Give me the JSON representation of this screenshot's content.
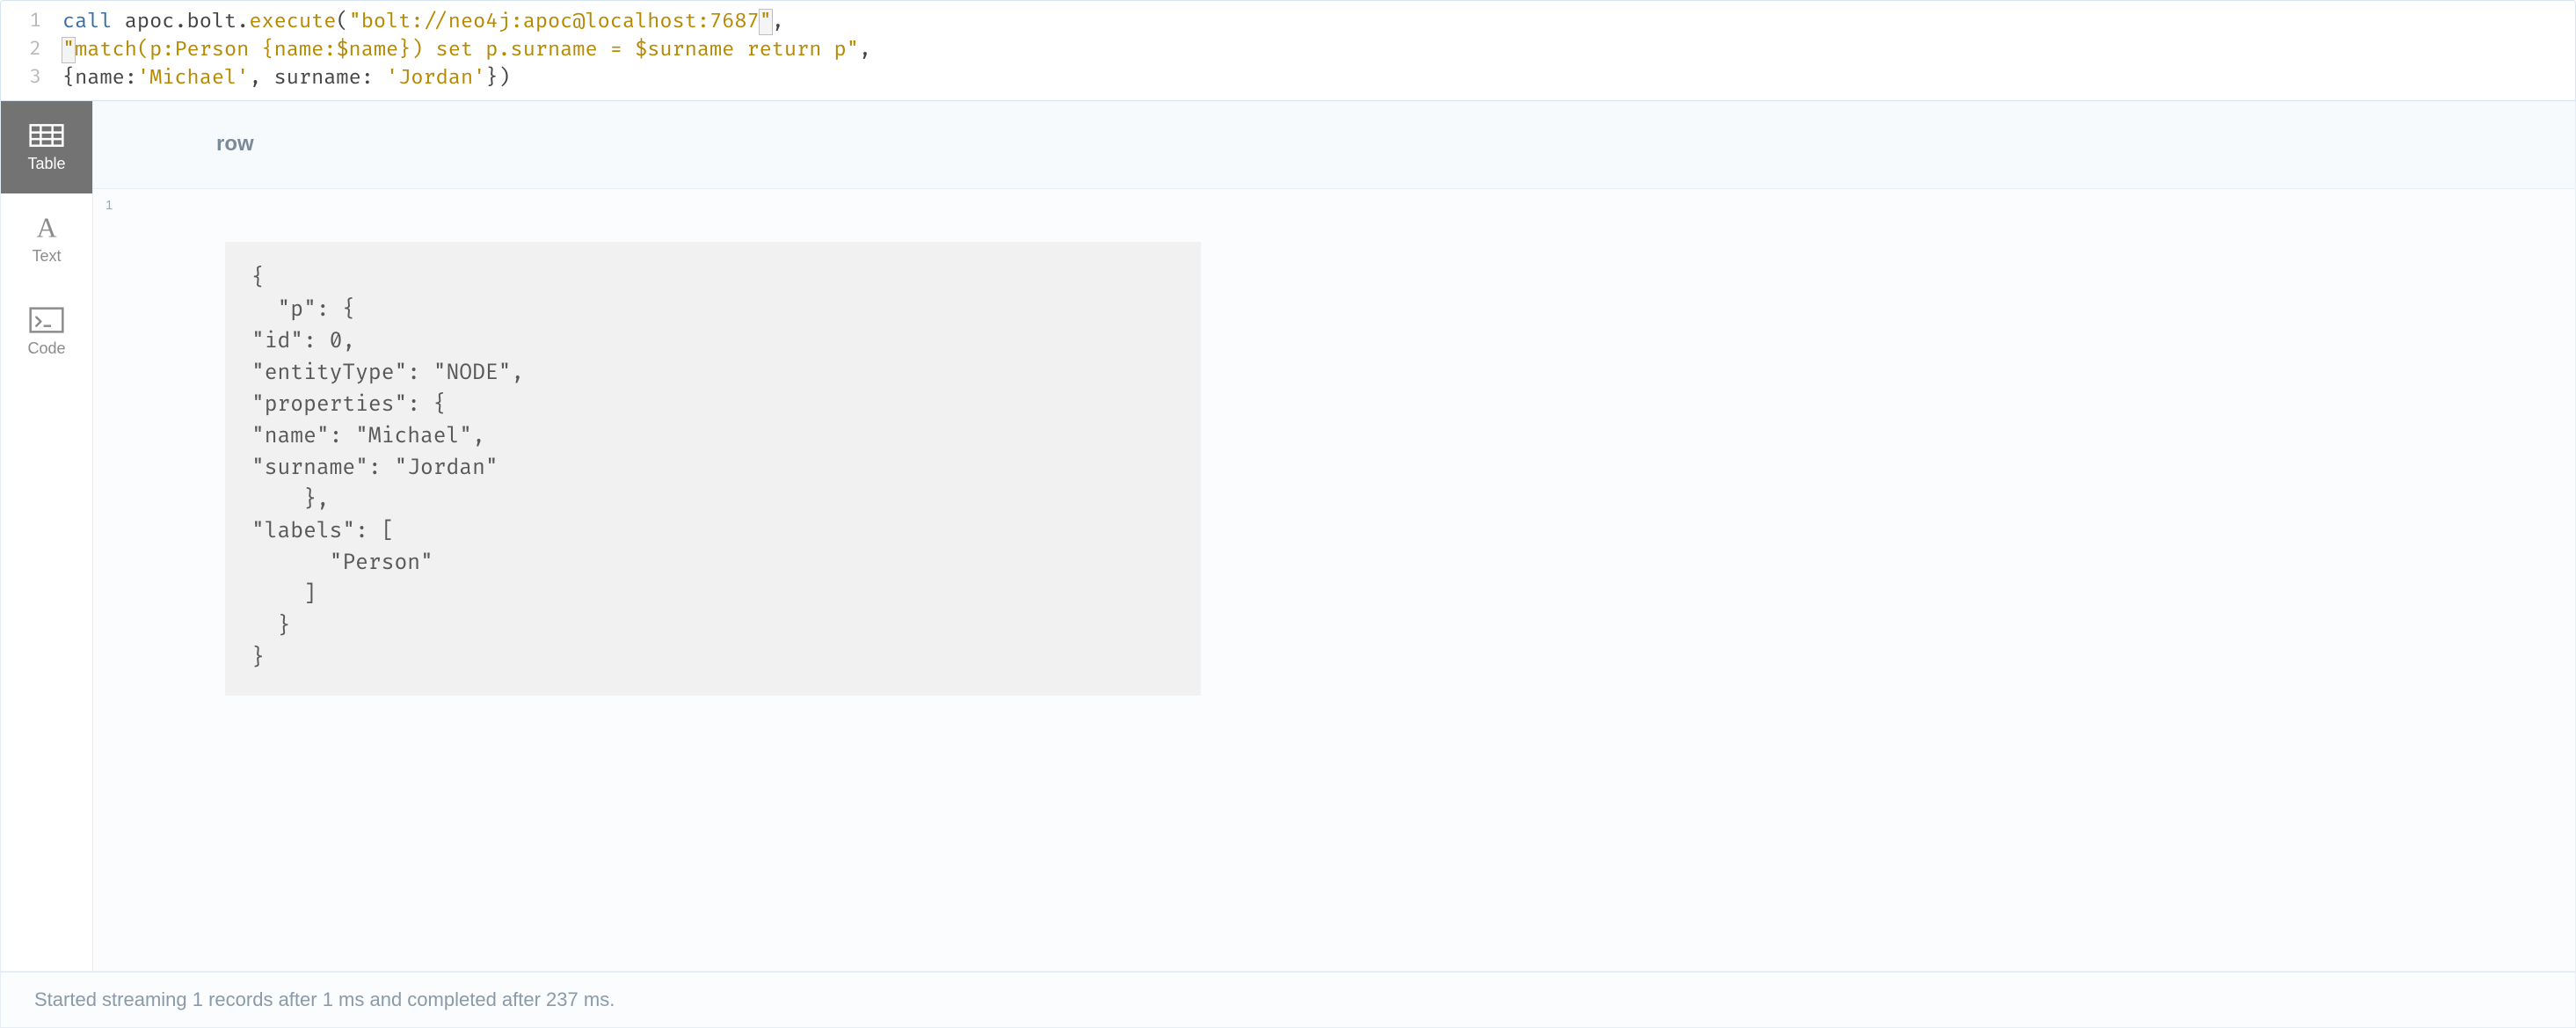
{
  "editor": {
    "lines": [
      {
        "num": "1"
      },
      {
        "num": "2"
      },
      {
        "num": "3"
      }
    ],
    "tokens": {
      "l1_call": "call",
      "l1_space1": " ",
      "l1_ns": "apoc.bolt.",
      "l1_fn": "execute",
      "l1_open": "(",
      "l1_q1a": "\"",
      "l1_str": "bolt://neo4j:apoc@localhost:7687",
      "l1_q1b": "\"",
      "l1_comma": ",",
      "l2_q2a": "\"",
      "l2_str": "match(p:Person {name:$name}) set p.surname = $surname return p\"",
      "l2_comma": ",",
      "l3_brace_open": "{",
      "l3_k1": "name:",
      "l3_v1": "'Michael'",
      "l3_comma": ", ",
      "l3_k2": "surname: ",
      "l3_v2": "'Jordan'",
      "l3_brace_close": "}",
      "l3_close": ")"
    }
  },
  "viewTabs": {
    "table": "Table",
    "text": "Text",
    "code": "Code"
  },
  "results": {
    "column": "row",
    "rowNum": "1",
    "json": "{\n  \"p\": {\n\"id\": 0,\n\"entityType\": \"NODE\",\n\"properties\": {\n\"name\": \"Michael\",\n\"surname\": \"Jordan\"\n    },\n\"labels\": [\n      \"Person\"\n    ]\n  }\n}"
  },
  "status": "Started streaming 1 records after 1 ms and completed after 237 ms."
}
